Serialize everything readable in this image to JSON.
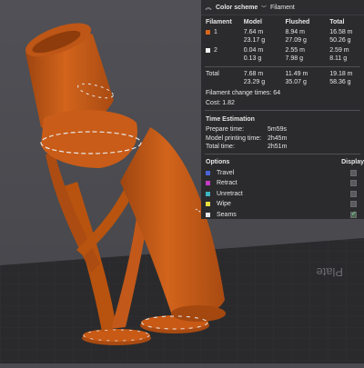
{
  "panel": {
    "title": "Color scheme",
    "scheme_value": "Filament",
    "columns": [
      "Filament",
      "Model",
      "Flushed",
      "Total"
    ],
    "rows": [
      {
        "id": "1",
        "color": "#d7661a",
        "model_len": "7.64 m",
        "model_wt": "23.17 g",
        "flushed_len": "8.94 m",
        "flushed_wt": "27.09 g",
        "total_len": "16.58 m",
        "total_wt": "50.26 g"
      },
      {
        "id": "2",
        "color": "#f2f2f2",
        "model_len": "0.04 m",
        "model_wt": "0.13 g",
        "flushed_len": "2.55 m",
        "flushed_wt": "7.98 g",
        "total_len": "2.59 m",
        "total_wt": "8.11 g"
      }
    ],
    "total": {
      "label": "Total",
      "model_len": "7.68 m",
      "model_wt": "23.29 g",
      "flushed_len": "11.49 m",
      "flushed_wt": "35.07 g",
      "total_len": "19.18 m",
      "total_wt": "58.36 g"
    },
    "filament_change": "Filament change times:  64",
    "cost": "Cost:  1.82",
    "time_title": "Time Estimation",
    "times": [
      {
        "label": "Prepare time:",
        "value": "5m59s"
      },
      {
        "label": "Model printing time:",
        "value": "2h45m"
      },
      {
        "label": "Total time:",
        "value": "2h51m"
      }
    ],
    "options_label": "Options",
    "display_label": "Display",
    "options": [
      {
        "label": "Travel",
        "color": "#4a64d8",
        "checked": false
      },
      {
        "label": "Retract",
        "color": "#c43cc4",
        "checked": false
      },
      {
        "label": "Unretract",
        "color": "#3cb6c4",
        "checked": false
      },
      {
        "label": "Wipe",
        "color": "#e8e040",
        "checked": false
      },
      {
        "label": "Seams",
        "color": "#e6e6e6",
        "checked": true
      }
    ]
  },
  "viewport": {
    "plate_text": "Plate",
    "filament_color": "#c85a16",
    "plate_color": "#2a2a2c"
  }
}
